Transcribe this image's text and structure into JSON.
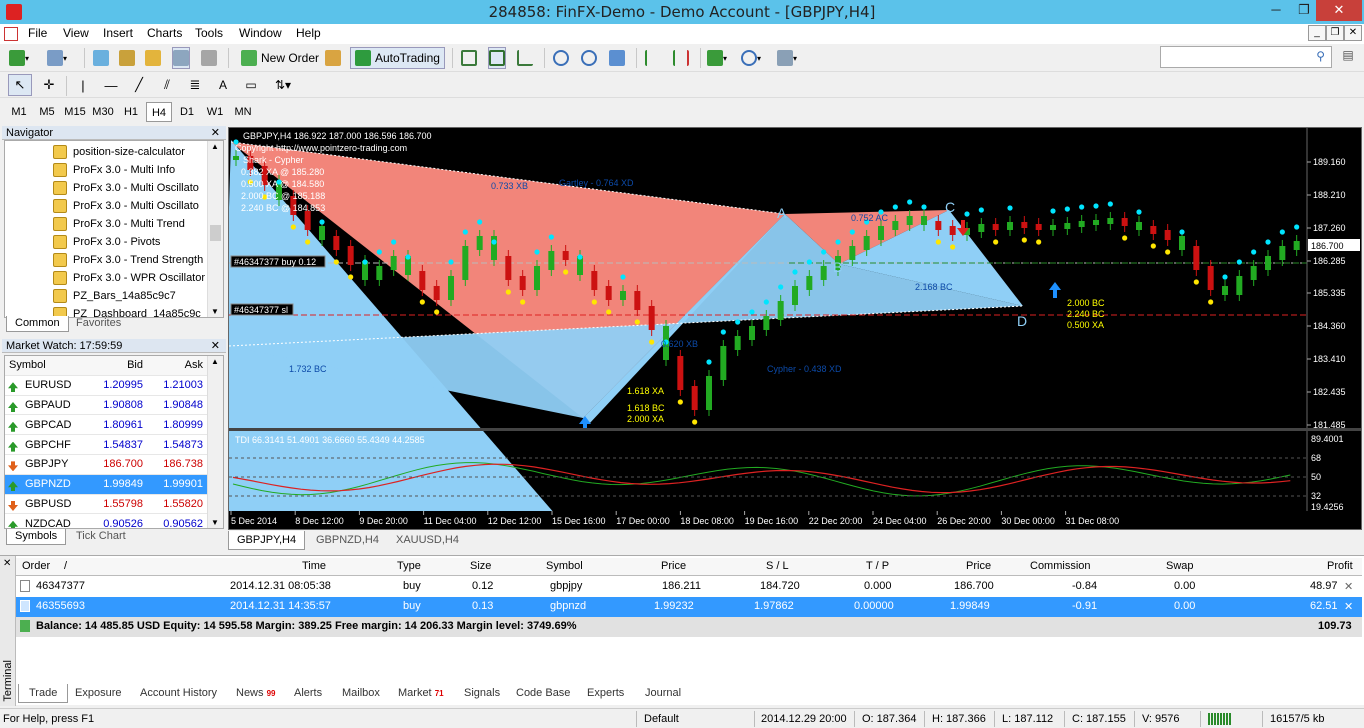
{
  "window": {
    "title": "284858: FinFX-Demo - Demo Account - [GBPJPY,H4]",
    "minimize": "─",
    "maximize": "❐",
    "close": "✕"
  },
  "menu": [
    "File",
    "View",
    "Insert",
    "Charts",
    "Tools",
    "Window",
    "Help"
  ],
  "toolbar": {
    "new_order": "New Order",
    "autotrading": "AutoTrading",
    "search_placeholder": ""
  },
  "timeframes": [
    "M1",
    "M5",
    "M15",
    "M30",
    "H1",
    "H4",
    "D1",
    "W1",
    "MN"
  ],
  "active_timeframe": "H4",
  "navigator": {
    "title": "Navigator",
    "items": [
      "position-size-calculator",
      "ProFx 3.0 - Multi Info",
      "ProFx 3.0 - Multi Oscillato",
      "ProFx 3.0 - Multi Oscillato",
      "ProFx 3.0 - Multi Trend",
      "ProFx 3.0 - Pivots",
      "ProFx 3.0 - Trend Strength",
      "ProFx 3.0 - WPR Oscillator",
      "PZ_Bars_14a85c9c7",
      "PZ_Dashboard_14a85c9c"
    ],
    "tabs": [
      "Common",
      "Favorites"
    ]
  },
  "market_watch": {
    "title": "Market Watch: 17:59:59",
    "headers": [
      "Symbol",
      "Bid",
      "Ask"
    ],
    "rows": [
      {
        "symbol": "EURUSD",
        "bid": "1.20995",
        "ask": "1.21003",
        "dir": "up",
        "color": "#0000cc"
      },
      {
        "symbol": "GBPAUD",
        "bid": "1.90808",
        "ask": "1.90848",
        "dir": "up",
        "color": "#0000cc"
      },
      {
        "symbol": "GBPCAD",
        "bid": "1.80961",
        "ask": "1.80999",
        "dir": "up",
        "color": "#0000cc"
      },
      {
        "symbol": "GBPCHF",
        "bid": "1.54837",
        "ask": "1.54873",
        "dir": "up",
        "color": "#0000cc"
      },
      {
        "symbol": "GBPJPY",
        "bid": "186.700",
        "ask": "186.738",
        "dir": "down",
        "color": "#cc0000"
      },
      {
        "symbol": "GBPNZD",
        "bid": "1.99849",
        "ask": "1.99901",
        "dir": "up",
        "color": "#ffffff"
      },
      {
        "symbol": "GBPUSD",
        "bid": "1.55798",
        "ask": "1.55820",
        "dir": "down",
        "color": "#cc0000"
      },
      {
        "symbol": "NZDCAD",
        "bid": "0.90526",
        "ask": "0.90562",
        "dir": "up",
        "color": "#0000cc"
      }
    ],
    "tabs": [
      "Symbols",
      "Tick Chart"
    ]
  },
  "chart": {
    "header": "GBPJPY,H4  186.922 187.000 186.596 186.700",
    "copyright": "Copyright  http://www.pointzero-trading.com",
    "pattern_name": "Shark - Cypher",
    "pattern_lines": [
      "0.382 XA @ 185.280",
      "0.500 XA @ 184.580",
      "2.000 BC @ 185.188",
      "2.240 BC @ 184.853"
    ],
    "labels": {
      "gartley": "Gartley - 0.764 XD",
      "cypher": "Cypher - 0.438 XD",
      "r733xb": "0.733 XB",
      "r1732bc": "1.732 BC",
      "r620xb": "0.620 XB",
      "r752ac": "0.752 AC",
      "r2168bc": "2.168 BC",
      "r618xa": "1.618 XA",
      "r1618bc": "1.618 BC",
      "r2000xa": "2.000 XA",
      "ptA": "A",
      "ptB": "B",
      "ptC": "C",
      "ptD": "D",
      "r2000bc": "2.000 BC",
      "r2240bc": "2.240 BC",
      "r500xa": "0.500 XA"
    },
    "order_buy": "#46347377 buy 0.12",
    "order_sl": "#46347377 sl",
    "current_price": "186.700",
    "price_ticks": [
      "189.160",
      "188.210",
      "187.260",
      "186.285",
      "185.335",
      "184.360",
      "183.410",
      "182.435",
      "181.485"
    ],
    "indicator_label": "TDI 66.3141 51.4901 36.6660 55.4349 44.2585",
    "indicator_ticks": [
      "89.4001",
      "68",
      "50",
      "32",
      "19.4256"
    ],
    "time_ticks": [
      "5 Dec 2014",
      "8 Dec 12:00",
      "9 Dec 20:00",
      "11 Dec 04:00",
      "12 Dec 12:00",
      "15 Dec 16:00",
      "17 Dec 00:00",
      "18 Dec 08:00",
      "19 Dec 16:00",
      "22 Dec 20:00",
      "24 Dec 04:00",
      "26 Dec 20:00",
      "30 Dec 00:00",
      "31 Dec 08:00"
    ],
    "tabs": [
      "GBPJPY,H4",
      "GBPNZD,H4",
      "XAUUSD,H4"
    ]
  },
  "terminal": {
    "side_label": "Terminal",
    "headers": [
      "Order",
      "/",
      "Time",
      "Type",
      "Size",
      "Symbol",
      "Price",
      "S / L",
      "T / P",
      "Price",
      "Commission",
      "Swap",
      "Profit"
    ],
    "rows": [
      {
        "order": "46347377",
        "time": "2014.12.31 08:05:38",
        "type": "buy",
        "size": "0.12",
        "symbol": "gbpjpy",
        "price": "186.211",
        "sl": "184.720",
        "tp": "0.000",
        "cur": "186.700",
        "comm": "-0.84",
        "swap": "0.00",
        "profit": "48.97"
      },
      {
        "order": "46355693",
        "time": "2014.12.31 14:35:57",
        "type": "buy",
        "size": "0.13",
        "symbol": "gbpnzd",
        "price": "1.99232",
        "sl": "1.97862",
        "tp": "0.00000",
        "cur": "1.99849",
        "comm": "-0.91",
        "swap": "0.00",
        "profit": "62.51"
      }
    ],
    "balance_line": "Balance: 14 485.85 USD  Equity: 14 595.58  Margin: 389.25  Free margin: 14 206.33  Margin level: 3749.69%",
    "balance_profit": "109.73",
    "tabs": [
      {
        "label": "Trade",
        "badge": ""
      },
      {
        "label": "Exposure",
        "badge": ""
      },
      {
        "label": "Account History",
        "badge": ""
      },
      {
        "label": "News",
        "badge": "99"
      },
      {
        "label": "Alerts",
        "badge": ""
      },
      {
        "label": "Mailbox",
        "badge": ""
      },
      {
        "label": "Market",
        "badge": "71"
      },
      {
        "label": "Signals",
        "badge": ""
      },
      {
        "label": "Code Base",
        "badge": ""
      },
      {
        "label": "Experts",
        "badge": ""
      },
      {
        "label": "Journal",
        "badge": ""
      }
    ]
  },
  "status": {
    "help": "For Help, press F1",
    "profile": "Default",
    "datetime": "2014.12.29 20:00",
    "open": "O: 187.364",
    "high": "H: 187.366",
    "low": "L: 187.112",
    "close": "C: 187.155",
    "volume": "V: 9576",
    "traffic": "16157/5 kb"
  },
  "colors": {
    "titlebar": "#5bc2ea",
    "chart_bg": "#000000",
    "bull": "#22aa22",
    "bear": "#cc1111",
    "pattern_red": "#f2857a",
    "pattern_blue": "#8fcff6",
    "selection": "#3399ff"
  },
  "chart_data": {
    "type": "candlestick",
    "symbol": "GBPJPY",
    "timeframe": "H4",
    "ylim": [
      181.485,
      189.6
    ],
    "indicator": "TDI",
    "indicator_ylim": [
      19.4256,
      89.4001
    ]
  }
}
